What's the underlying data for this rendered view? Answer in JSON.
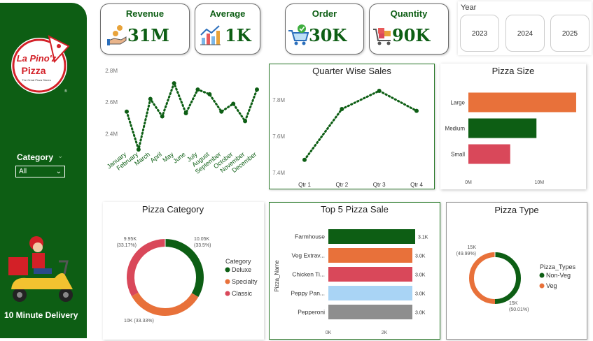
{
  "sidebar": {
    "logo_line1": "La Pino'z",
    "logo_line2": "Pizza",
    "logo_tagline": "The Great Pizza Stores",
    "category_label": "Category",
    "category_value": "All",
    "delivery_text": "10 Minute Delivery"
  },
  "kpis": [
    {
      "title": "Revenue",
      "value": "31M",
      "icon": "money-hand-icon"
    },
    {
      "title": "Average",
      "value": "1K",
      "icon": "bar-chart-icon"
    },
    {
      "title": "Order",
      "value": "30K",
      "icon": "shopping-cart-check-icon"
    },
    {
      "title": "Quantity",
      "value": "90K",
      "icon": "cart-boxes-icon"
    }
  ],
  "year_slicer": {
    "label": "Year",
    "options": [
      "2023",
      "2024",
      "2025"
    ]
  },
  "colors": {
    "dark_green": "#0d5e14",
    "orange": "#e8713a",
    "red": "#d9485a",
    "light_blue": "#a9d4f5",
    "gray": "#8e8e8e"
  },
  "monthly_chart": {
    "chart_data": {
      "type": "line",
      "categories": [
        "January",
        "February",
        "March",
        "April",
        "May",
        "June",
        "July",
        "August",
        "September",
        "October",
        "November",
        "December"
      ],
      "series": [
        {
          "values": [
            2.54,
            2.3,
            2.62,
            2.51,
            2.72,
            2.53,
            2.68,
            2.65,
            2.54,
            2.59,
            2.48,
            2.68
          ]
        }
      ],
      "ylim": [
        2.3,
        2.8
      ],
      "yticks": [
        "2.8M",
        "2.6M",
        "2.4M"
      ],
      "ytick_values": [
        2.8,
        2.6,
        2.4
      ],
      "grid": false,
      "line_style": "dotted"
    }
  },
  "quarter_chart": {
    "title": "Quarter Wise Sales",
    "chart_data": {
      "type": "line",
      "categories": [
        "Qtr 1",
        "Qtr 2",
        "Qtr 3",
        "Qtr 4"
      ],
      "series": [
        {
          "values": [
            7.47,
            7.75,
            7.85,
            7.74
          ]
        }
      ],
      "ylim": [
        7.4,
        7.9
      ],
      "yticks": [
        "7.8M",
        "7.6M",
        "7.4M"
      ],
      "ytick_values": [
        7.8,
        7.6,
        7.4
      ],
      "grid": false,
      "line_style": "dotted"
    }
  },
  "size_chart": {
    "title": "Pizza Size",
    "chart_data": {
      "type": "bar",
      "orientation": "horizontal",
      "categories": [
        "Large",
        "Medium",
        "Small"
      ],
      "values": [
        15.2,
        9.6,
        5.9
      ],
      "bar_colors": [
        "#e8713a",
        "#0d5e14",
        "#d9485a"
      ],
      "xlim": [
        0,
        15.5
      ],
      "xticks": [
        "0M",
        "10M"
      ],
      "xtick_values": [
        0,
        10
      ]
    }
  },
  "category_chart": {
    "title": "Pizza Category",
    "legend_title": "Category",
    "chart_data": {
      "type": "pie",
      "style": "donut",
      "categories": [
        "Deluxe",
        "Specialty",
        "Classic"
      ],
      "values": [
        10.05,
        10,
        9.95
      ],
      "labels": [
        "10.05K",
        "10K (33.33%)",
        "9.95K"
      ],
      "sublabels": [
        "(33.5%)",
        "",
        "(33.17%)"
      ],
      "colors": [
        "#0d5e14",
        "#e8713a",
        "#d9485a"
      ],
      "legend": "right"
    }
  },
  "top5_chart": {
    "title": "Top 5 Pizza Sale",
    "ylabel": "Pizza_Name",
    "chart_data": {
      "type": "bar",
      "orientation": "horizontal",
      "categories": [
        "Farmhouse",
        "Veg Extrav...",
        "Chicken Ti...",
        "Peppy Pan...",
        "Pepperoni"
      ],
      "values": [
        3.1,
        3.0,
        3.0,
        3.0,
        3.0
      ],
      "data_labels": [
        "3.1K",
        "3.0K",
        "3.0K",
        "3.0K",
        "3.0K"
      ],
      "bar_colors": [
        "#0d5e14",
        "#e8713a",
        "#d9485a",
        "#a9d4f5",
        "#8e8e8e"
      ],
      "xlim": [
        0,
        3.1
      ],
      "xticks": [
        "0K",
        "2K"
      ],
      "xtick_values": [
        0,
        2
      ]
    }
  },
  "type_chart": {
    "title": "Pizza Type",
    "legend_title": "Pizza_Types",
    "chart_data": {
      "type": "pie",
      "style": "donut",
      "categories": [
        "Non-Veg",
        "Veg"
      ],
      "values": [
        50.01,
        49.99
      ],
      "labels": [
        "15K",
        "15K"
      ],
      "sublabels": [
        "(50.01%)",
        "(49.99%)"
      ],
      "colors": [
        "#0d5e14",
        "#e8713a"
      ],
      "legend": "right"
    }
  }
}
